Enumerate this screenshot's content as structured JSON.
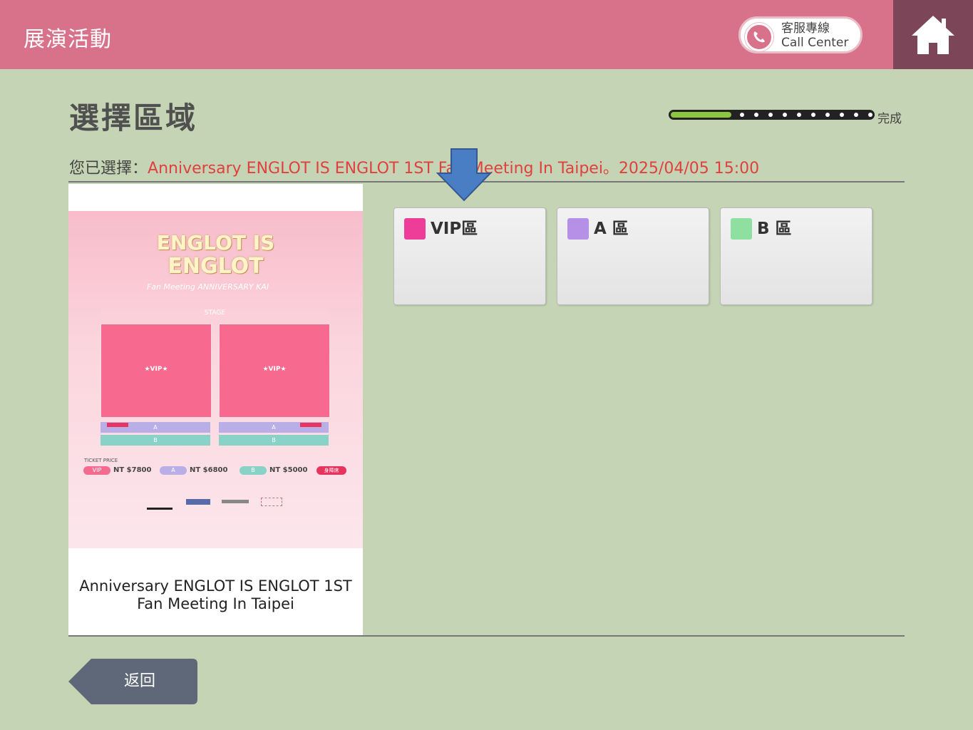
{
  "header": {
    "title": "展演活動",
    "call_center_zh": "客服專線",
    "call_center_en": "Call Center",
    "call_icon": "phone-icon",
    "home_icon": "home-icon"
  },
  "page": {
    "title": "選擇區域",
    "progress_label": "完成",
    "progress_fraction": 0.3
  },
  "selection": {
    "prefix": "您已選擇：",
    "value": "Anniversary ENGLOT IS ENGLOT 1ST Fan Meeting In Taipei。2025/04/05 15:00"
  },
  "event": {
    "name_line1": "Anniversary ENGLOT IS ENGLOT 1ST",
    "name_line2": "Fan Meeting In Taipei",
    "poster": {
      "logo_line1": "ENGLOT IS",
      "logo_line2": "ENGLOT",
      "subtitle": "Fan Meeting ANNIVERSARY KAI",
      "stage": "STAGE",
      "vip_label": "★VIP★",
      "a_label": "A",
      "b_label": "B",
      "ticket_price_label": "TICKET PRICE",
      "prices": [
        {
          "zone": "VIP",
          "price": "NT $7800"
        },
        {
          "zone": "A",
          "price": "NT $6800"
        },
        {
          "zone": "B",
          "price": "NT $5000"
        }
      ],
      "badge": "身障席"
    }
  },
  "zones": [
    {
      "label": "VIP區",
      "color": "#ee3d98"
    },
    {
      "label": "A 區",
      "color": "#b690e6"
    },
    {
      "label": "B 區",
      "color": "#8ee0a0"
    }
  ],
  "footer": {
    "back_label": "返回"
  },
  "colors": {
    "header_bg": "#d8728a",
    "home_bg": "#7d4558",
    "page_bg": "#c4d4b4",
    "accent_red": "#e0403e",
    "progress_green": "#8cc63f",
    "arrow_blue": "#4a7ec4",
    "back_button": "#5e6878"
  }
}
